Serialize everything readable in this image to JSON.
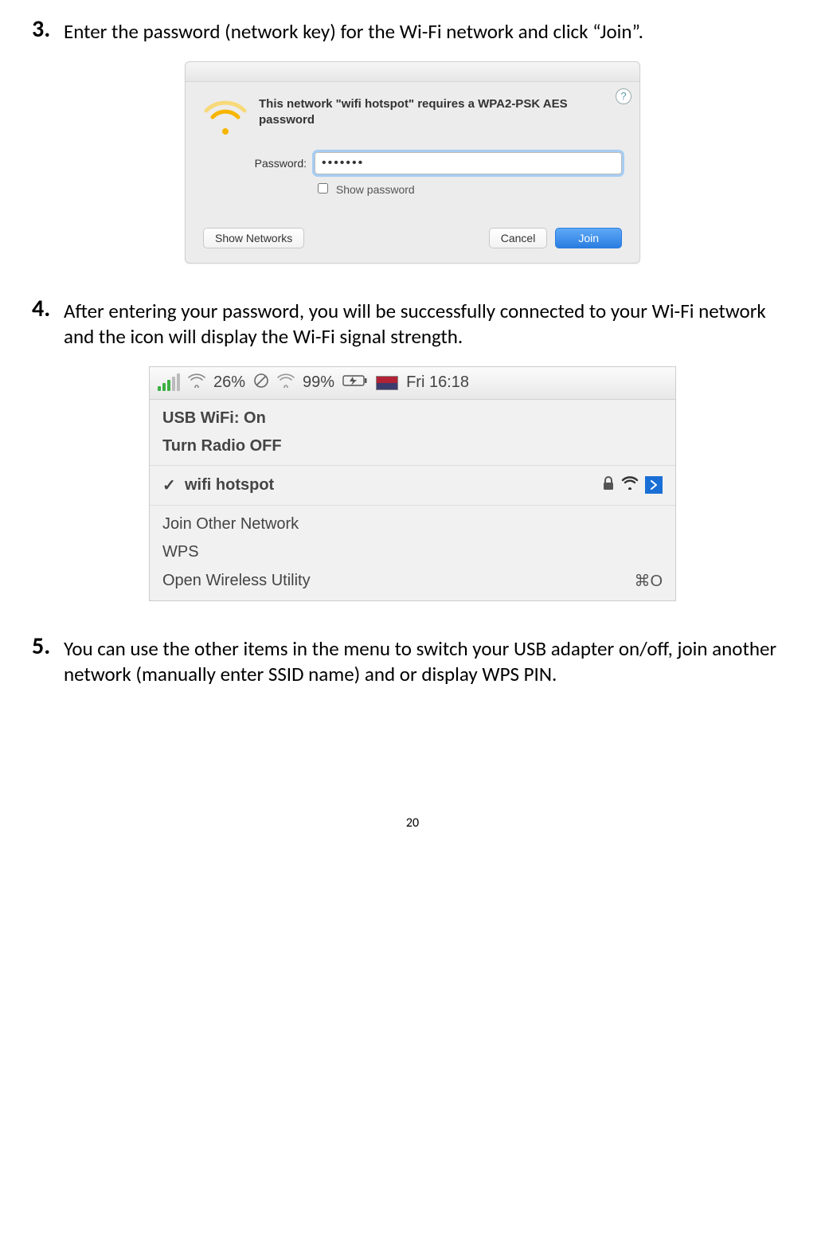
{
  "steps": {
    "s3": {
      "num": "3.",
      "text": "Enter the password (network key) for the Wi-Fi network and click “Join”."
    },
    "s4": {
      "num": "4.",
      "text": "After entering your password, you will be successfully connected to your Wi-Fi network and the icon will display the Wi-Fi signal strength."
    },
    "s5": {
      "num": "5.",
      "text": "You can use the other items in the menu to switch your USB adapter on/off, join another network (manually enter SSID name) and or display WPS PIN."
    }
  },
  "dialog": {
    "help": "?",
    "title": "This network \"wifi hotspot\" requires a WPA2-PSK AES password",
    "password_label": "Password:",
    "password_value": "•••••••",
    "show_password": "Show password",
    "show_networks": "Show Networks",
    "cancel": "Cancel",
    "join": "Join"
  },
  "menubar": {
    "percent1": "26%",
    "percent2": "99%",
    "clock": "Fri 16:18",
    "status_title": "USB WiFi: On",
    "turn_off": "Turn Radio OFF",
    "connected_net": "wifi hotspot",
    "join_other": "Join Other Network",
    "wps": "WPS",
    "open_util": "Open Wireless Utility",
    "shortcut": "⌘O",
    "check": "✓"
  },
  "page_number": "20"
}
